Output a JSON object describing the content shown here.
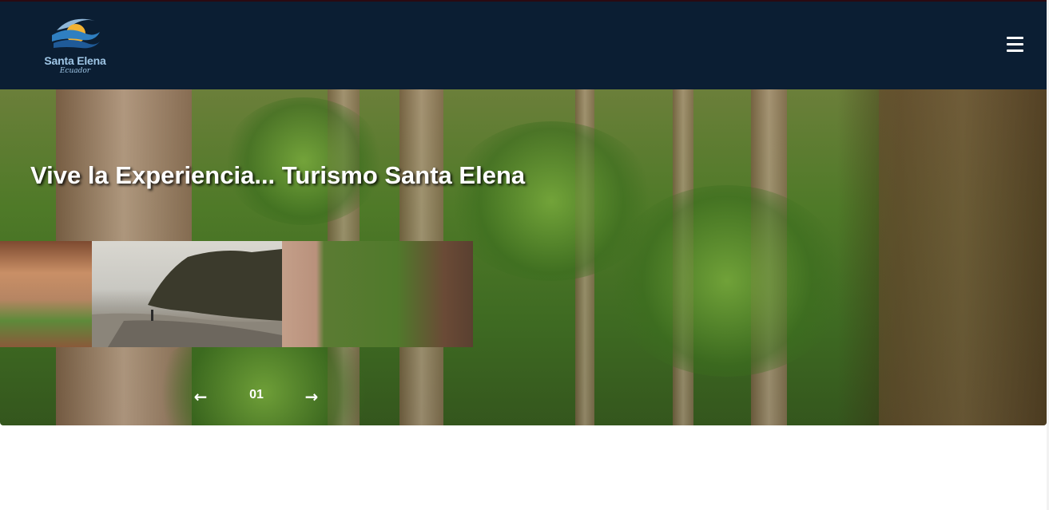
{
  "header": {
    "logo": {
      "name": "Santa Elena",
      "subtitle": "Ecuador",
      "icon": "wave-sun-logo"
    },
    "menu_icon": "hamburger-menu-icon",
    "background_color": "#0b1e33"
  },
  "hero": {
    "title": "Vive la Experiencia... Turismo Santa Elena",
    "slides": [
      {
        "label": "restaurant-palm-thumbnail"
      },
      {
        "label": "beach-cliff-thumbnail"
      },
      {
        "label": "forest-thumbnail"
      }
    ],
    "controls": {
      "prev_icon": "arrow-left-icon",
      "prev_glyph": "🡐",
      "next_icon": "arrow-right-icon",
      "next_glyph": "🡒",
      "counter": "01"
    }
  }
}
